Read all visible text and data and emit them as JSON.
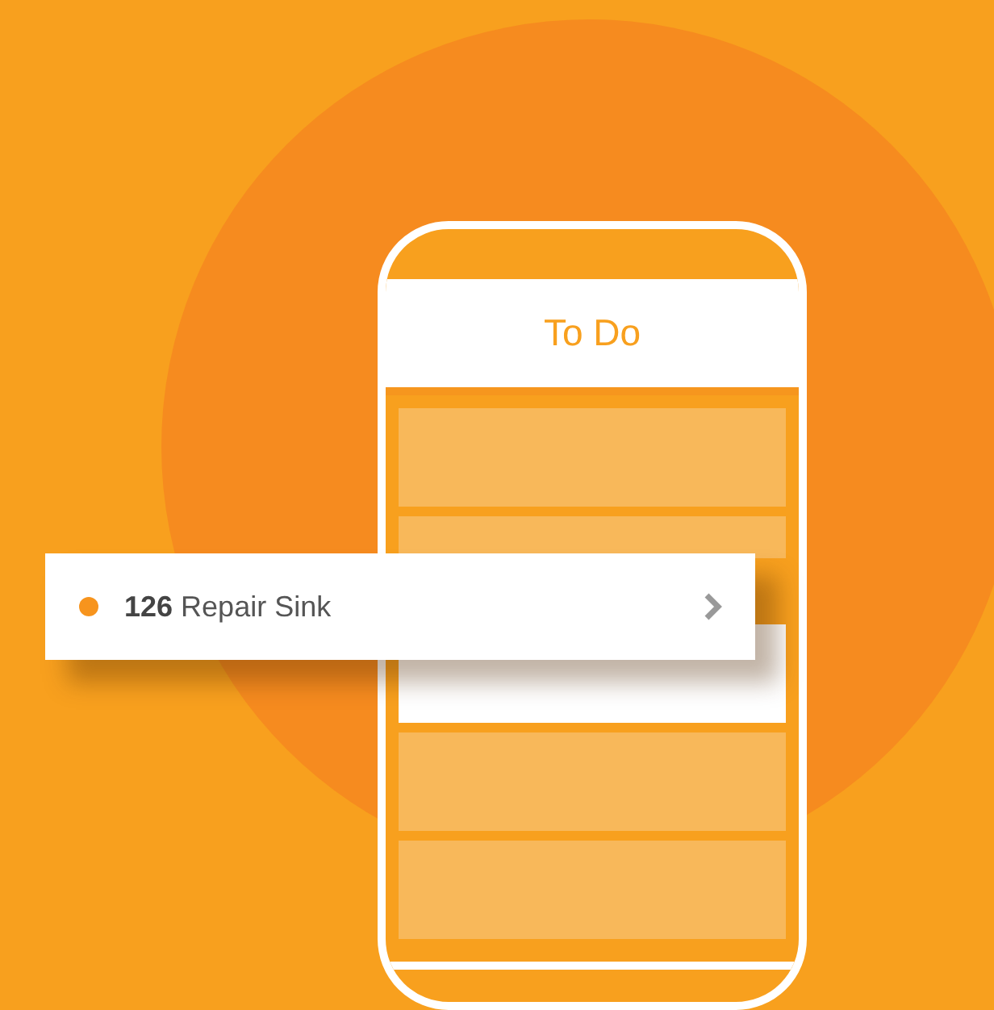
{
  "phone": {
    "title": "To Do",
    "rows": [
      {
        "selected": false
      },
      {
        "selected": false
      },
      {
        "selected": true
      },
      {
        "selected": false
      },
      {
        "selected": false
      }
    ]
  },
  "task_card": {
    "label": "**126** Repair Sink"
  }
}
